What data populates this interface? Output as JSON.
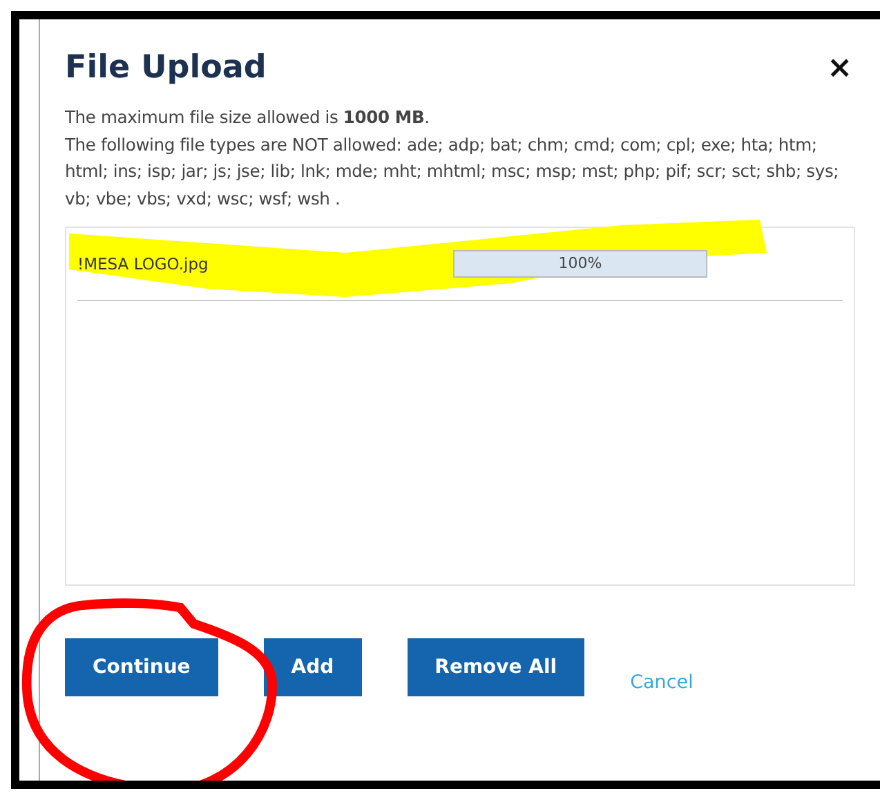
{
  "dialog": {
    "title": "File Upload",
    "close": "×",
    "size_note": "The maximum file size allowed is **1000 MB**.",
    "types_note": "The following file types are NOT allowed: ade; adp; bat; chm; cmd; com; cpl; exe; hta; htm; html; ins; isp; jar; js; jse; lib; lnk; mde; mht; mhtml; msc; msp; mst; php; pif; scr; sct; shb; sys; vb; vbe; vbs; vxd; wsc; wsf; wsh ."
  },
  "files": [
    {
      "name": "!MESA LOGO.jpg",
      "level": 1,
      "reading": "100%"
    }
  ],
  "buttons": [
    {
      "label": "Continue",
      "kind": "button"
    },
    {
      "label": "Add",
      "kind": "button"
    },
    {
      "label": "Remove All",
      "kind": "button"
    },
    {
      "label": "Cancel",
      "kind": "link"
    }
  ]
}
